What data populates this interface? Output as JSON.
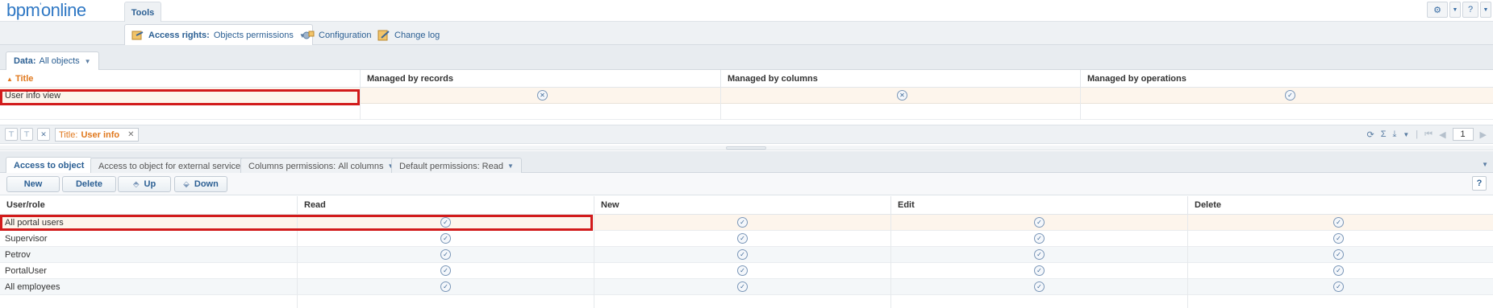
{
  "header": {
    "logo_text": "bpm",
    "logo_sup": "'",
    "logo_text2": "online",
    "tools_tab": "Tools",
    "icons": [
      "gear-icon",
      "chevron-down-icon",
      "help-icon",
      "chevron-down-icon"
    ]
  },
  "section_nav": {
    "access_rights_label": "Access rights:",
    "access_rights_value": "Objects permissions",
    "configuration": "Configuration",
    "change_log": "Change log"
  },
  "data_filter": {
    "label": "Data:",
    "value": "All objects"
  },
  "objects_grid": {
    "columns": [
      "Title",
      "Managed by records",
      "Managed by columns",
      "Managed by operations"
    ],
    "rows": [
      {
        "title": "User info view",
        "records": "cross",
        "columns": "cross",
        "operations": "check"
      }
    ]
  },
  "filter_bar": {
    "chip_label": "Title:",
    "chip_value": "User info",
    "page": "1"
  },
  "detail_tabs": {
    "tab1": "Access to object",
    "tab2": "Access to object for external services",
    "tab3_label": "Columns permissions:",
    "tab3_value": "All columns",
    "tab4_label": "Default permissions:",
    "tab4_value": "Read"
  },
  "toolbar": {
    "new": "New",
    "delete": "Delete",
    "up": "Up",
    "down": "Down"
  },
  "roles_grid": {
    "columns": [
      "User/role",
      "Read",
      "New",
      "Edit",
      "Delete"
    ],
    "rows": [
      {
        "role": "All portal users",
        "read": true,
        "new": true,
        "edit": true,
        "delete": true
      },
      {
        "role": "Supervisor",
        "read": true,
        "new": true,
        "edit": true,
        "delete": true
      },
      {
        "role": "Petrov",
        "read": true,
        "new": true,
        "edit": true,
        "delete": true
      },
      {
        "role": "PortalUser",
        "read": true,
        "new": true,
        "edit": true,
        "delete": true
      },
      {
        "role": "All employees",
        "read": true,
        "new": true,
        "edit": true,
        "delete": true
      }
    ]
  },
  "colors": {
    "accent": "#2b5f93",
    "sort_orange": "#e0781d",
    "highlight_red": "#d21b1b",
    "selected_row": "#fdf5ec"
  }
}
